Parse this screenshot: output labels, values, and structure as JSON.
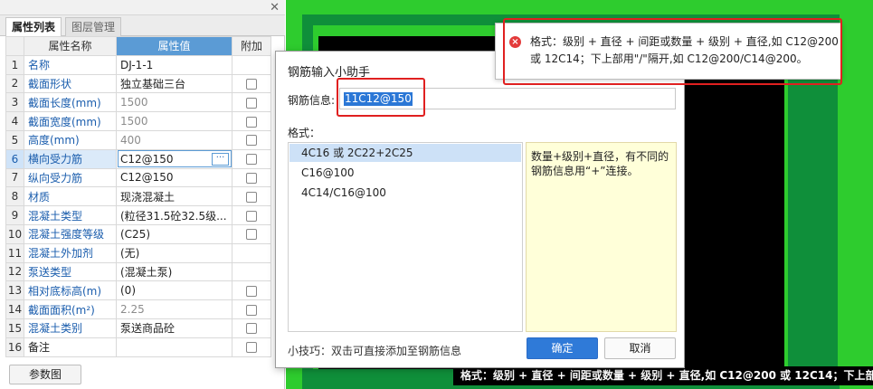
{
  "panel": {
    "close_glyph": "✕",
    "tabs": [
      {
        "label": "属性列表",
        "active": true
      },
      {
        "label": "图层管理",
        "active": false
      }
    ],
    "columns": {
      "name": "属性名称",
      "value": "属性值",
      "extra": "附加"
    },
    "rows": [
      {
        "idx": "1",
        "name": "名称",
        "value": "DJ-1-1",
        "checkbox": false,
        "grey": false
      },
      {
        "idx": "2",
        "name": "截面形状",
        "value": "独立基础三台",
        "checkbox": true,
        "grey": false
      },
      {
        "idx": "3",
        "name": "截面长度(mm)",
        "value": "1500",
        "checkbox": true,
        "grey": true
      },
      {
        "idx": "4",
        "name": "截面宽度(mm)",
        "value": "1500",
        "checkbox": true,
        "grey": true
      },
      {
        "idx": "5",
        "name": "高度(mm)",
        "value": "400",
        "checkbox": true,
        "grey": true
      },
      {
        "idx": "6",
        "name": "横向受力筋",
        "value": "C12@150",
        "checkbox": true,
        "grey": false,
        "selected": true
      },
      {
        "idx": "7",
        "name": "纵向受力筋",
        "value": "C12@150",
        "checkbox": true,
        "grey": false
      },
      {
        "idx": "8",
        "name": "材质",
        "value": "现浇混凝土",
        "checkbox": true,
        "grey": false
      },
      {
        "idx": "9",
        "name": "混凝土类型",
        "value": "(粒径31.5砼32.5级...",
        "checkbox": true,
        "grey": false
      },
      {
        "idx": "10",
        "name": "混凝土强度等级",
        "value": "(C25)",
        "checkbox": true,
        "grey": false
      },
      {
        "idx": "11",
        "name": "混凝土外加剂",
        "value": "(无)",
        "checkbox": false,
        "grey": false
      },
      {
        "idx": "12",
        "name": "泵送类型",
        "value": "(混凝土泵)",
        "checkbox": false,
        "grey": false
      },
      {
        "idx": "13",
        "name": "相对底标高(m)",
        "value": "(0)",
        "checkbox": true,
        "grey": false
      },
      {
        "idx": "14",
        "name": "截面面积(m²)",
        "value": "2.25",
        "checkbox": true,
        "grey": true
      },
      {
        "idx": "15",
        "name": "混凝土类别",
        "value": "泵送商品砼",
        "checkbox": true,
        "grey": false
      },
      {
        "idx": "16",
        "name": "备注",
        "value": "",
        "checkbox": true,
        "grey": false,
        "plain": true
      }
    ],
    "param_button": "参数图"
  },
  "dialog": {
    "title": "钢筋输入小助手",
    "info_label": "钢筋信息:",
    "info_value": "11C12@150",
    "format_label": "格式：",
    "formats": [
      "4C16 或 2C22+2C25",
      "C16@100",
      "4C14/C16@100"
    ],
    "selected_format": 0,
    "description": "数量+级别+直径，有不同的钢筋信息用“+”连接。",
    "tip": "小技巧：双击可直接添加至钢筋信息",
    "ok": "确定",
    "cancel": "取消"
  },
  "error": {
    "icon": "×",
    "line1": "格式：级别 + 直径 + 间距或数量 + 级别 + 直径,如 C12@200",
    "line2": "或 12C14；下上部用\"/\"隔开,如 C12@200/C14@200。"
  },
  "command_line": "格式：级别 + 直径 + 间距或数量 + 级别 + 直径,如 C12@200 或 12C14；下上部用",
  "colors": {
    "cad_green": "#2ecc2e",
    "cad_dark_green": "#0f8f3a",
    "cad_black": "#000000",
    "selection_blue": "#2b77d6",
    "highlight_red": "#e02020",
    "note_yellow": "#ffffd9"
  }
}
